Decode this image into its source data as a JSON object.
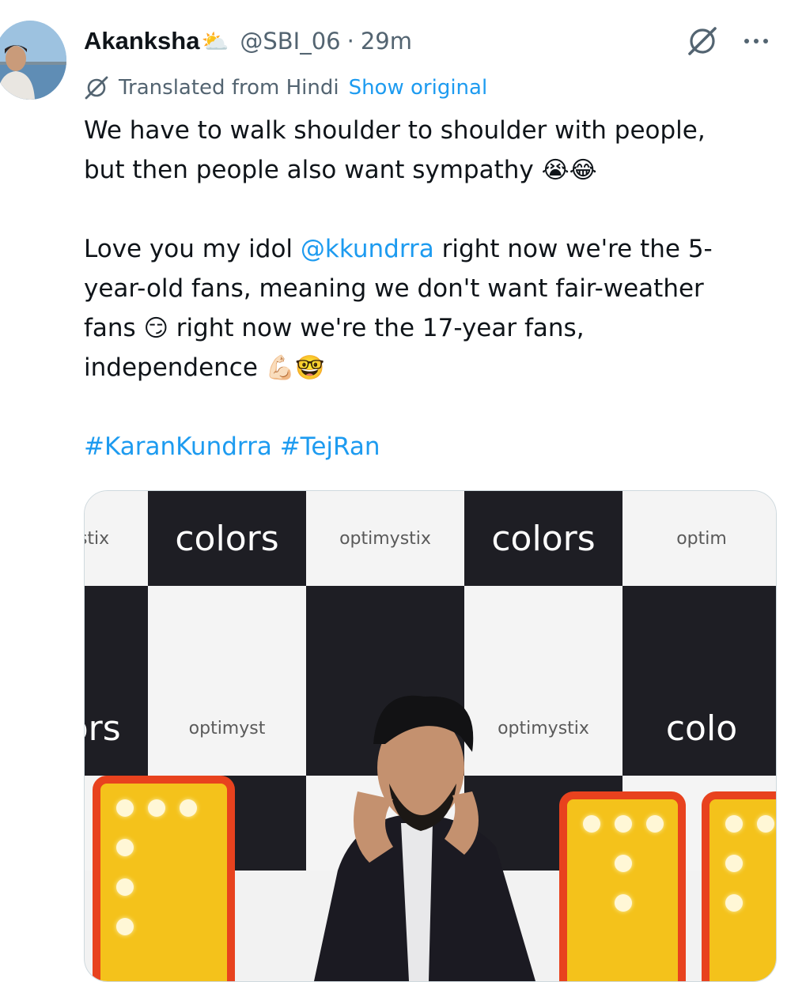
{
  "author": {
    "name": "Akanksha",
    "name_emoji": "⛅",
    "handle": "@SBI_06",
    "separator": "·",
    "time": "29m"
  },
  "icons": {
    "grok": "grok-icon",
    "more": "more-icon",
    "translate": "translate-icon"
  },
  "translation": {
    "text": "Translated from Hindi",
    "show_original": "Show original"
  },
  "tweet": {
    "line1": "We have to walk shoulder to shoulder with people,",
    "line2_text": "but then people also want sympathy ",
    "line2_emoji": "😭😂",
    "line3_pre": "Love you my idol ",
    "line3_mention": "@kkundrra",
    "line3_post": " right now we're the 5-",
    "line4": "year-old fans, meaning we don't want fair-weather",
    "line5_pre": "fans ",
    "line5_emoji": "😏",
    "line5_post": " right now we're the 17-year fans,",
    "line6_text": "independence ",
    "line6_emoji": "💪🏻🤓",
    "hashtags": "#KaranKundrra #TejRan"
  },
  "media": {
    "brand_dark": "colors",
    "brand_light": "optimystix",
    "brand_dark_partial_1": "colors",
    "brand_dark_partial_2": "colo",
    "brand_dark_partial_3": "s",
    "brand_light_partial_1": "ptimystix",
    "brand_light_partial_2": "optim",
    "brand_light_partial_3": "optimyst"
  },
  "colors": {
    "link": "#1d9bf0",
    "secondary_text": "#536471",
    "primary_text": "#0f1419"
  }
}
